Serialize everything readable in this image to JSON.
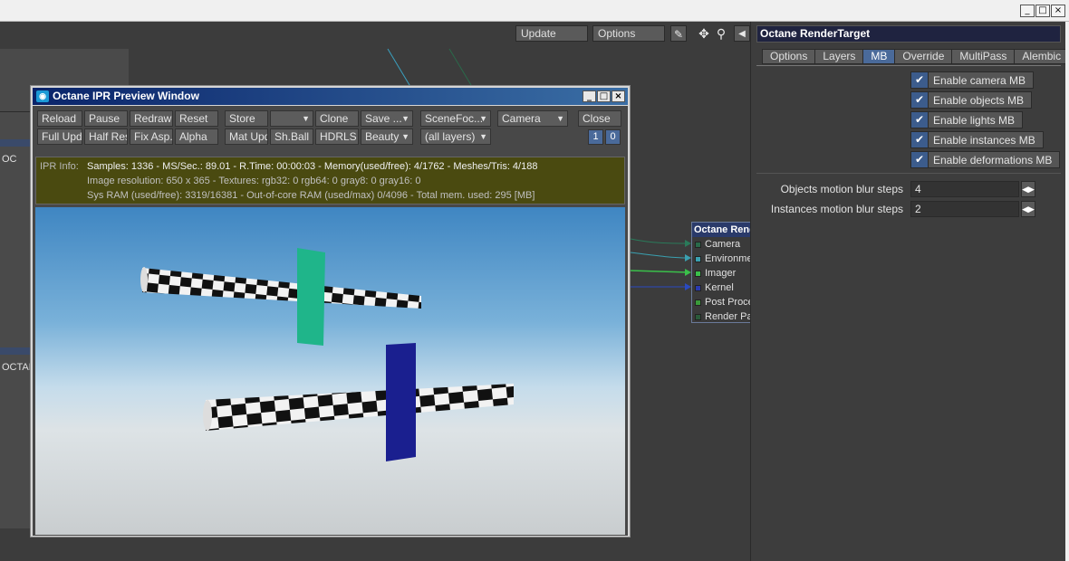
{
  "window": {
    "min_btn": "_",
    "max_btn": "□",
    "close_btn": "×"
  },
  "node_editor": {
    "toolbar": {
      "update_label": "Update",
      "options_label": "Options"
    },
    "left_labels": {
      "oc_a": "OC",
      "octan": "OCTAN"
    },
    "octane_node": {
      "title": "Octane Rend",
      "ports": [
        "Camera",
        "Environme",
        "Imager",
        "Kernel",
        "Post Proce",
        "Render Pa"
      ],
      "port_colors": [
        "#2a6a4a",
        "#3aa0b0",
        "#3ac04a",
        "#2a3ab0",
        "#3a9a3a",
        "#2a5a3a"
      ]
    }
  },
  "properties": {
    "title": "Octane RenderTarget",
    "tabs": [
      "Options",
      "Layers",
      "MB",
      "Override",
      "MultiPass",
      "Alembic"
    ],
    "active_tab": "MB",
    "checks": [
      {
        "label": "Enable camera MB",
        "checked": true
      },
      {
        "label": "Enable objects MB",
        "checked": true
      },
      {
        "label": "Enable lights MB",
        "checked": true
      },
      {
        "label": "Enable instances MB",
        "checked": true
      },
      {
        "label": "Enable deformations MB",
        "checked": true
      }
    ],
    "objects_blur_label": "Objects motion blur steps",
    "objects_blur_value": "4",
    "instances_blur_label": "Instances motion blur steps",
    "instances_blur_value": "2"
  },
  "ipr": {
    "title": "Octane IPR Preview Window",
    "row1": {
      "reload": "Reload",
      "pause": "Pause",
      "redraw": "Redraw",
      "reset": "Reset",
      "store": "Store",
      "store_slot": "",
      "clone": "Clone",
      "save": "Save ...",
      "scene_focus": "SceneFoc...",
      "camera": "Camera",
      "close": "Close"
    },
    "row2": {
      "full_upd": "Full Upd.",
      "half_res": "Half Res",
      "fix_asp": "Fix Asp.",
      "alpha": "Alpha",
      "mat_upd": "Mat Upd",
      "sh_ball": "Sh.Ball",
      "hdrls": "HDRLS",
      "beauty": "Beauty",
      "layers": "(all layers)",
      "num1": "1",
      "num2": "0"
    },
    "info": {
      "label": "IPR Info:",
      "line1": "Samples: 1336  -  MS/Sec.: 89.01  -  R.Time: 00:00:03 - Memory(used/free): 4/1762  -  Meshes/Tris: 4/188",
      "line2": "Image resolution: 650 x 365  -  Textures:  rgb32: 0   rgb64: 0   gray8: 0   gray16: 0",
      "line3": "Sys RAM (used/free): 3319/16381  -  Out-of-core RAM (used/max) 0/4096  -  Total mem. used: 295  [MB]"
    }
  },
  "scene_colors": {
    "green_plane": "#1fb58a",
    "blue_plane": "#1a1f8f"
  }
}
